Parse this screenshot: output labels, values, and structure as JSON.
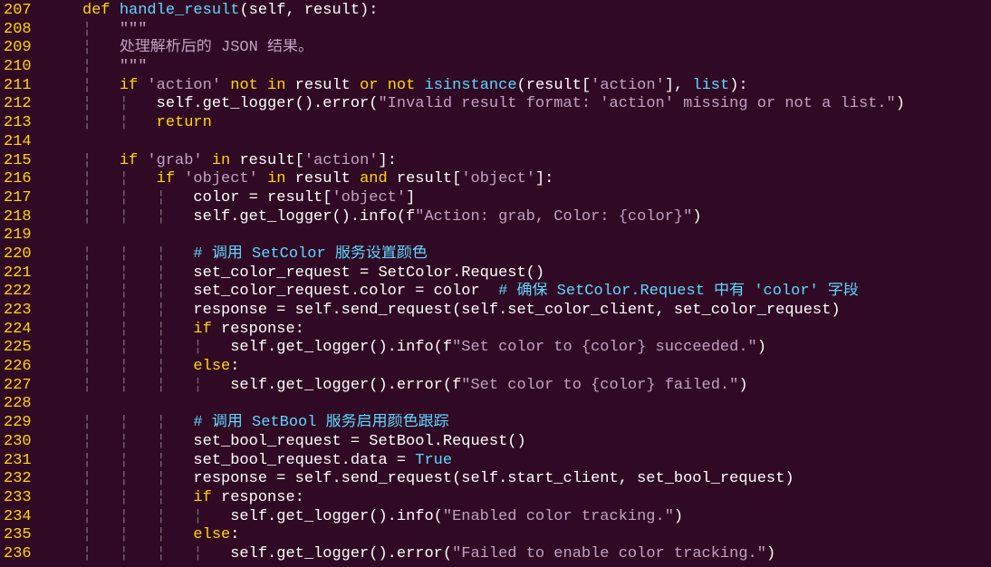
{
  "colors": {
    "background": "#300a24",
    "line_number": "#ffd700",
    "keyword": "#ffd700",
    "function": "#5fd7ff",
    "string": "#c0a0c6",
    "comment": "#5fd7ff",
    "text": "#ffffff",
    "indent_guide": "#7a6473"
  },
  "lines": [
    {
      "num": "207",
      "tokens": [
        [
          "kw",
          "def "
        ],
        [
          "fn",
          "handle_result"
        ],
        [
          "tx",
          "(self, result):"
        ]
      ]
    },
    {
      "num": "208",
      "tokens": [
        [
          "guide",
          "¦   "
        ],
        [
          "str",
          "\"\"\""
        ]
      ]
    },
    {
      "num": "209",
      "tokens": [
        [
          "guide",
          "¦   "
        ],
        [
          "str",
          "处理解析后的 JSON 结果。"
        ]
      ]
    },
    {
      "num": "210",
      "tokens": [
        [
          "guide",
          "¦   "
        ],
        [
          "str",
          "\"\"\""
        ]
      ]
    },
    {
      "num": "211",
      "tokens": [
        [
          "guide",
          "¦   "
        ],
        [
          "kw",
          "if "
        ],
        [
          "str",
          "'action'"
        ],
        [
          "tx",
          " "
        ],
        [
          "kw",
          "not in"
        ],
        [
          "tx",
          " result "
        ],
        [
          "kw",
          "or not"
        ],
        [
          "tx",
          " "
        ],
        [
          "bi",
          "isinstance"
        ],
        [
          "tx",
          "(result["
        ],
        [
          "str",
          "'action'"
        ],
        [
          "tx",
          "], "
        ],
        [
          "bi",
          "list"
        ],
        [
          "tx",
          "):"
        ]
      ]
    },
    {
      "num": "212",
      "tokens": [
        [
          "guide",
          "¦   ¦   "
        ],
        [
          "tx",
          "self.get_logger().error("
        ],
        [
          "str",
          "\"Invalid result format: 'action' missing or not a list.\""
        ],
        [
          "tx",
          ")"
        ]
      ]
    },
    {
      "num": "213",
      "tokens": [
        [
          "guide",
          "¦   ¦   "
        ],
        [
          "kw",
          "return"
        ]
      ]
    },
    {
      "num": "214",
      "tokens": []
    },
    {
      "num": "215",
      "tokens": [
        [
          "guide",
          "¦   "
        ],
        [
          "kw",
          "if "
        ],
        [
          "str",
          "'grab'"
        ],
        [
          "tx",
          " "
        ],
        [
          "kw",
          "in"
        ],
        [
          "tx",
          " result["
        ],
        [
          "str",
          "'action'"
        ],
        [
          "tx",
          "]:"
        ]
      ]
    },
    {
      "num": "216",
      "tokens": [
        [
          "guide",
          "¦   ¦   "
        ],
        [
          "kw",
          "if "
        ],
        [
          "str",
          "'object'"
        ],
        [
          "tx",
          " "
        ],
        [
          "kw",
          "in"
        ],
        [
          "tx",
          " result "
        ],
        [
          "kw",
          "and"
        ],
        [
          "tx",
          " result["
        ],
        [
          "str",
          "'object'"
        ],
        [
          "tx",
          "]:"
        ]
      ]
    },
    {
      "num": "217",
      "tokens": [
        [
          "guide",
          "¦   ¦   ¦   "
        ],
        [
          "tx",
          "color = result["
        ],
        [
          "str",
          "'object'"
        ],
        [
          "tx",
          "]"
        ]
      ]
    },
    {
      "num": "218",
      "tokens": [
        [
          "guide",
          "¦   ¦   ¦   "
        ],
        [
          "tx",
          "self.get_logger().info(f"
        ],
        [
          "str",
          "\"Action: grab, Color: {color}\""
        ],
        [
          "tx",
          ")"
        ]
      ]
    },
    {
      "num": "219",
      "tokens": []
    },
    {
      "num": "220",
      "tokens": [
        [
          "guide",
          "¦   ¦   ¦   "
        ],
        [
          "cm",
          "# 调用 SetColor 服务设置颜色"
        ]
      ]
    },
    {
      "num": "221",
      "tokens": [
        [
          "guide",
          "¦   ¦   ¦   "
        ],
        [
          "tx",
          "set_color_request = SetColor.Request()"
        ]
      ]
    },
    {
      "num": "222",
      "tokens": [
        [
          "guide",
          "¦   ¦   ¦   "
        ],
        [
          "tx",
          "set_color_request.color = color  "
        ],
        [
          "cm",
          "# 确保 SetColor.Request 中有 'color' 字段"
        ]
      ]
    },
    {
      "num": "223",
      "tokens": [
        [
          "guide",
          "¦   ¦   ¦   "
        ],
        [
          "tx",
          "response = self.send_request(self.set_color_client, set_color_request)"
        ]
      ]
    },
    {
      "num": "224",
      "tokens": [
        [
          "guide",
          "¦   ¦   ¦   "
        ],
        [
          "kw",
          "if"
        ],
        [
          "tx",
          " response:"
        ]
      ]
    },
    {
      "num": "225",
      "tokens": [
        [
          "guide",
          "¦   ¦   ¦   ¦   "
        ],
        [
          "tx",
          "self.get_logger().info(f"
        ],
        [
          "str",
          "\"Set color to {color} succeeded.\""
        ],
        [
          "tx",
          ")"
        ]
      ]
    },
    {
      "num": "226",
      "tokens": [
        [
          "guide",
          "¦   ¦   ¦   "
        ],
        [
          "kw",
          "else"
        ],
        [
          "tx",
          ":"
        ]
      ]
    },
    {
      "num": "227",
      "tokens": [
        [
          "guide",
          "¦   ¦   ¦   ¦   "
        ],
        [
          "tx",
          "self.get_logger().error(f"
        ],
        [
          "str",
          "\"Set color to {color} failed.\""
        ],
        [
          "tx",
          ")"
        ]
      ]
    },
    {
      "num": "228",
      "tokens": []
    },
    {
      "num": "229",
      "tokens": [
        [
          "guide",
          "¦   ¦   ¦   "
        ],
        [
          "cm",
          "# 调用 SetBool 服务启用颜色跟踪"
        ]
      ]
    },
    {
      "num": "230",
      "tokens": [
        [
          "guide",
          "¦   ¦   ¦   "
        ],
        [
          "tx",
          "set_bool_request = SetBool.Request()"
        ]
      ]
    },
    {
      "num": "231",
      "tokens": [
        [
          "guide",
          "¦   ¦   ¦   "
        ],
        [
          "tx",
          "set_bool_request.data = "
        ],
        [
          "bi",
          "True"
        ]
      ]
    },
    {
      "num": "232",
      "tokens": [
        [
          "guide",
          "¦   ¦   ¦   "
        ],
        [
          "tx",
          "response = self.send_request(self.start_client, set_bool_request)"
        ]
      ]
    },
    {
      "num": "233",
      "tokens": [
        [
          "guide",
          "¦   ¦   ¦   "
        ],
        [
          "kw",
          "if"
        ],
        [
          "tx",
          " response:"
        ]
      ]
    },
    {
      "num": "234",
      "tokens": [
        [
          "guide",
          "¦   ¦   ¦   ¦   "
        ],
        [
          "tx",
          "self.get_logger().info("
        ],
        [
          "str",
          "\"Enabled color tracking.\""
        ],
        [
          "tx",
          ")"
        ]
      ]
    },
    {
      "num": "235",
      "tokens": [
        [
          "guide",
          "¦   ¦   ¦   "
        ],
        [
          "kw",
          "else"
        ],
        [
          "tx",
          ":"
        ]
      ]
    },
    {
      "num": "236",
      "tokens": [
        [
          "guide",
          "¦   ¦   ¦   ¦   "
        ],
        [
          "tx",
          "self.get_logger().error("
        ],
        [
          "str",
          "\"Failed to enable color tracking.\""
        ],
        [
          "tx",
          ")"
        ]
      ]
    }
  ]
}
